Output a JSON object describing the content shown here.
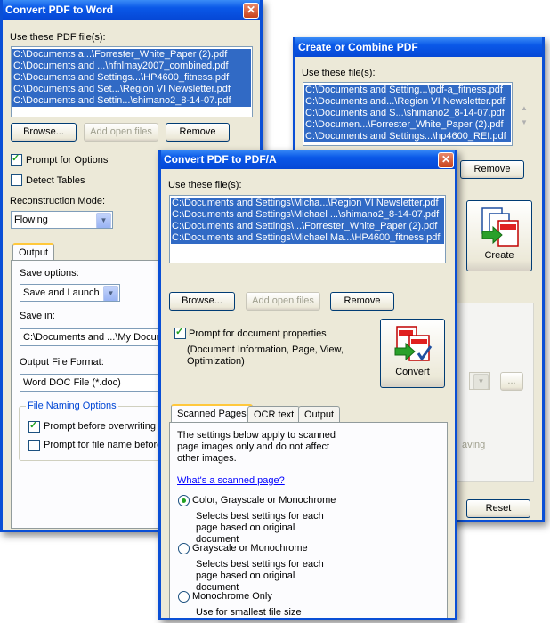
{
  "win1": {
    "title": "Convert PDF to Word",
    "files_label": "Use these PDF file(s):",
    "files": [
      "C:\\Documents a...\\Forrester_White_Paper (2).pdf",
      "C:\\Documents and ...\\hfnlmay2007_combined.pdf",
      "C:\\Documents and Settings...\\HP4600_fitness.pdf",
      "C:\\Documents and Set...\\Region VI Newsletter.pdf",
      "C:\\Documents and Settin...\\shimano2_8-14-07.pdf"
    ],
    "browse": "Browse...",
    "add_open": "Add open files",
    "remove": "Remove",
    "prompt_options": "Prompt for Options",
    "detect_tables": "Detect Tables",
    "recon_label": "Reconstruction Mode:",
    "recon_value": "Flowing",
    "tab_output": "Output",
    "save_options_label": "Save options:",
    "save_options_value": "Save and Launch",
    "save_in_label": "Save in:",
    "save_in_value": "C:\\Documents and ...\\My Documents",
    "format_label": "Output File Format:",
    "format_value": "Word DOC File (*.doc)",
    "naming_group": "File Naming Options",
    "prompt_overwrite": "Prompt before overwriting",
    "prompt_filename": "Prompt for file name before saving"
  },
  "win2": {
    "title": "Create or Combine PDF",
    "files_label": "Use these file(s):",
    "files": [
      "C:\\Documents and Setting...\\pdf-a_fitness.pdf",
      "C:\\Documents and...\\Region VI Newsletter.pdf",
      "C:\\Documents and S...\\shimano2_8-14-07.pdf",
      "C:\\Documen...\\Forrester_White_Paper (2).pdf",
      "C:\\Documents and Settings...\\hp4600_REI.pdf"
    ],
    "remove": "Remove",
    "create": "Create",
    "ellipsis": "...",
    "saving_text": "aving",
    "reset": "Reset"
  },
  "win3": {
    "title": "Convert PDF to PDF/A",
    "files_label": "Use these file(s):",
    "files": [
      "C:\\Documents and Settings\\Micha...\\Region VI Newsletter.pdf",
      "C:\\Documents and Settings\\Michael ...\\shimano2_8-14-07.pdf",
      "C:\\Documents and Settings\\...\\Forrester_White_Paper (2).pdf",
      "C:\\Documents and Settings\\Michael Ma...\\HP4600_fitness.pdf"
    ],
    "browse": "Browse...",
    "add_open": "Add open files",
    "remove": "Remove",
    "prompt_props": "Prompt for document properties",
    "props_desc": "(Document Information, Page, View, Optimization)",
    "convert": "Convert",
    "tabs": [
      "Scanned Pages",
      "OCR text",
      "Output"
    ],
    "scanned_desc": "The settings below apply to scanned page images only and do not affect other images.",
    "link": "What's a scanned page?",
    "opt1": "Color, Grayscale or Monochrome",
    "opt1_desc": "Selects best settings for each page based on original document",
    "opt2": "Grayscale or Monochrome",
    "opt2_desc": "Selects best settings for each page based on original document",
    "opt3": "Monochrome Only",
    "opt3_desc": "Use for smallest file size"
  },
  "colors": {
    "title_blue": "#0a58e8",
    "selection": "#316ac5",
    "window_bg": "#ece9d8"
  }
}
